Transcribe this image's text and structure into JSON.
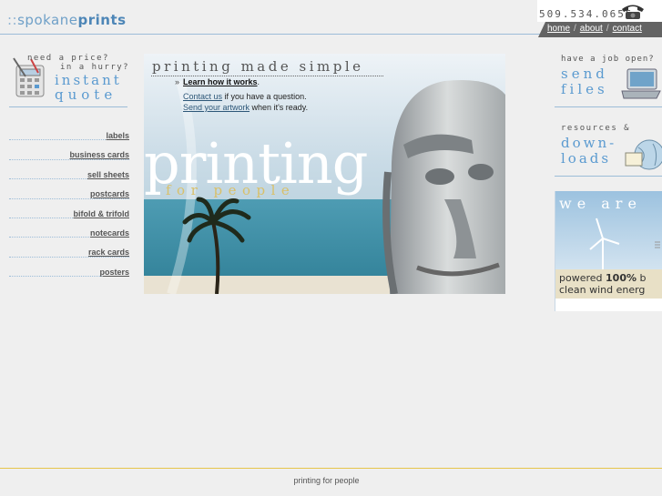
{
  "header": {
    "logo_prefix": "::",
    "logo_light": "spokane",
    "logo_bold": "prints",
    "phone": "509.534.0655",
    "nav": [
      {
        "label": "home"
      },
      {
        "label": "about"
      },
      {
        "label": "contact"
      }
    ],
    "nav_separator": "/"
  },
  "quote": {
    "line1": "need a price?",
    "line2": "in a hurry?",
    "line3": "instant",
    "line4": "quote"
  },
  "products": [
    {
      "label": "labels"
    },
    {
      "label": "business cards"
    },
    {
      "label": "sell sheets"
    },
    {
      "label": "postcards"
    },
    {
      "label": "bifold & trifold"
    },
    {
      "label": "notecards"
    },
    {
      "label": "rack cards"
    },
    {
      "label": "posters"
    }
  ],
  "banner": {
    "title": "printing made simple",
    "bullet": "»",
    "learn_link": "Learn how it works",
    "learn_suffix": ".",
    "contact_link": "Contact us",
    "contact_text": " if you have a question.",
    "upload_link": "Send your artwork",
    "upload_text": " when it's ready.",
    "big_word": "printing",
    "tagline": "for people"
  },
  "job": {
    "line1": "have a job open?",
    "line2": "send",
    "line3": "files"
  },
  "resources": {
    "line1": "resources &",
    "line2": "down-",
    "line3": "loads"
  },
  "wind": {
    "headline": "we are",
    "powered_prefix": "powered ",
    "percent": "100%",
    "powered_suffix": " b",
    "line2": "clean wind energ"
  },
  "footer": {
    "text": "printing for people"
  },
  "colors": {
    "accent_blue": "#5a9ad0",
    "rule_blue": "#9cbcd8",
    "nav_bar": "#636363",
    "footer_rule": "#e6c54a"
  }
}
